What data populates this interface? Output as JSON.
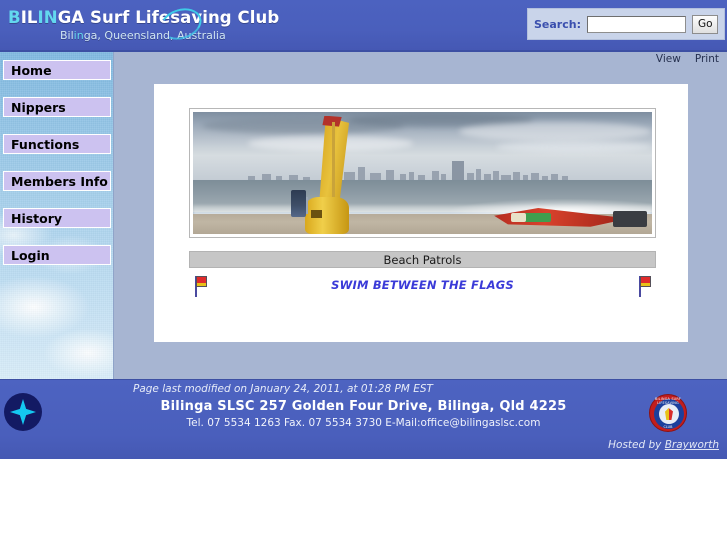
{
  "header": {
    "logo_line1_parts": [
      {
        "text": "B",
        "color": "cyan"
      },
      {
        "text": "IL",
        "color": "white"
      },
      {
        "text": "IN",
        "color": "cyan"
      },
      {
        "text": "GA Surf Lifesaving Club",
        "color": "white"
      }
    ],
    "logo_line1_full": "BILINGA Surf Lifesaving Club",
    "logo_line2_pre": "Bil",
    "logo_line2_mid": "in",
    "logo_line2_post": "ga, Queensland, Australia",
    "logo_line2_full": "Bilinga, Queensland, Australia",
    "search_label": "Search:",
    "search_value": "",
    "search_placeholder": "",
    "search_button": "Go"
  },
  "actionbar": {
    "view": "View",
    "print": "Print"
  },
  "sidebar": {
    "items": [
      {
        "label": "Home"
      },
      {
        "label": "Nippers"
      },
      {
        "label": "Functions"
      },
      {
        "label": "Members Info"
      },
      {
        "label": "History"
      },
      {
        "label": "Login"
      }
    ]
  },
  "main": {
    "photo_alt": "Surf rescue board and patrol flag on Bilinga beach with Gold Coast skyline",
    "caption": "Beach Patrols",
    "slogan": "SWIM BETWEEN THE FLAGS"
  },
  "footer": {
    "last_modified": "Page last modified on January 24, 2011, at 01:28 PM EST",
    "address": "Bilinga SLSC 257 Golden Four Drive, Bilinga, Qld 4225",
    "contact": "Tel. 07 5534 1263 Fax. 07 5534 3730 E-Mail:office@bilingaslsc.com",
    "hosted_prefix": "Hosted by ",
    "hosted_link": "Brayworth",
    "club_badge_top": "BILINGA SURF LIFESAVING",
    "club_badge_bottom": "CLUB"
  },
  "colors": {
    "header_blue": "#4a60bd",
    "page_backdrop": "#a7b5d2",
    "menu_button": "#ccc2f0",
    "caption_grey": "#c6c6c6",
    "slogan_blue": "#3a3ad8",
    "flag_red": "#e02b2b",
    "flag_yellow": "#e8c118"
  }
}
